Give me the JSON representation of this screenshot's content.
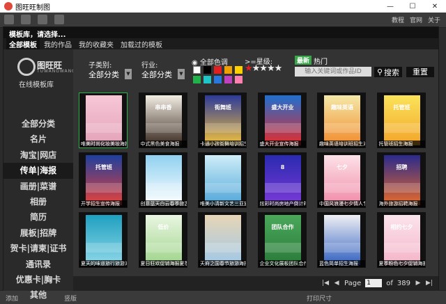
{
  "window": {
    "title": "图旺旺制图",
    "minimize": "—",
    "maximize": "☐",
    "close": "✕"
  },
  "background": {
    "links": [
      "教程",
      "官网",
      "关于"
    ],
    "bottom": [
      "添加",
      "竖版",
      "打印尺寸"
    ]
  },
  "dialog": {
    "title": "模板库，请选择...",
    "tabs": [
      "全部模板",
      "我的作品",
      "我的收藏夹",
      "加载过的模板"
    ],
    "active_tab": 0
  },
  "sidebar": {
    "logo_name": "图旺旺",
    "logo_sub": "TUWANGWANG",
    "logo_tag": "在线模板库",
    "categories": [
      "全部分类",
      "名片",
      "淘宝|网店",
      "传单|海报",
      "画册|菜谱",
      "相册",
      "简历",
      "展板|招牌",
      "贺卡|请柬|证书",
      "通讯录",
      "优惠卡|胸卡",
      "其他"
    ],
    "active_index": 3
  },
  "filters": {
    "subcategory_label": "子类别:",
    "subcategory_value": "全部分类",
    "industry_label": "行业:",
    "industry_value": "全部分类",
    "color_label": "全部色调",
    "colors": [
      "#ffffff",
      "#000000",
      "#e02020",
      "#f0a000",
      "#ffd000",
      "#22b24a",
      "#1fc6c8",
      "#2878e0",
      "#c040c0",
      "#ff80b0"
    ],
    "star_label": ">=星级:",
    "stars": "★★★★★",
    "latest_label": "最新",
    "hot_label": "热门",
    "search_placeholder": "输入关键词或作品ID",
    "search_button": "搜索",
    "reset_button": "重置"
  },
  "templates": [
    {
      "caption": "唯美时尚化妆美妆海报",
      "c1": "#f7c7d6",
      "c2": "#e3a2b8",
      "text": ""
    },
    {
      "caption": "中式黑色美食海报",
      "c1": "#f2ede3",
      "c2": "#3a2a20",
      "text": "串串香"
    },
    {
      "caption": "卡通小孩街舞培训招生海报",
      "c1": "#2c3a9a",
      "c2": "#f3c23c",
      "text": "街舞班"
    },
    {
      "caption": "盛大开业宣传海报",
      "c1": "#1f6fd0",
      "c2": "#e52b2b",
      "text": "盛大开业"
    },
    {
      "caption": "趣味英语培训班招生海报",
      "c1": "#f4e9a8",
      "c2": "#f18b2c",
      "text": "趣味英语"
    },
    {
      "caption": "托管班招生海报",
      "c1": "#fbe35a",
      "c2": "#f3a429",
      "text": "托管班"
    },
    {
      "caption": "开学招生宣传海报",
      "c1": "#1d3f9e",
      "c2": "#e8423a",
      "text": "托管班"
    },
    {
      "caption": "创意蓝天白云春季旅游海报",
      "c1": "#8fd0f0",
      "c2": "#ffffff",
      "text": ""
    },
    {
      "caption": "唯美小清新文艺三亚旅游海报",
      "c1": "#cfeef8",
      "c2": "#4fa6d8",
      "text": ""
    },
    {
      "caption": "炫彩时尚房地产倒计时海报",
      "c1": "#2a2ab0",
      "c2": "#7a3ad8",
      "text": "8"
    },
    {
      "caption": "中国风浪漫七夕情人节海报",
      "c1": "#fde2e8",
      "c2": "#f08aa8",
      "text": "七夕"
    },
    {
      "caption": "海外旅游招聘海报",
      "c1": "#2a2a8c",
      "c2": "#e86a2a",
      "text": "招聘"
    },
    {
      "caption": "夏天的味道旅行旅游海报",
      "c1": "#1fa0c0",
      "c2": "#8ed8e8",
      "text": ""
    },
    {
      "caption": "夏日狂欢促销海报夏季购",
      "c1": "#eaf6e2",
      "c2": "#9ed48a",
      "text": "低价"
    },
    {
      "caption": "天府之国春节旅游海报",
      "c1": "#e8d5b5",
      "c2": "#a0c8e8",
      "text": ""
    },
    {
      "caption": "企业文化展板团队合作海报",
      "c1": "#4aa85a",
      "c2": "#2a7a3a",
      "text": "团队合作"
    },
    {
      "caption": "蓝色简单招生海报",
      "c1": "#f0f0f4",
      "c2": "#3060c0",
      "text": ""
    },
    {
      "caption": "夏季粉色七夕促销海报",
      "c1": "#fbe4ec",
      "c2": "#f4b4c8",
      "text": "相约七夕"
    }
  ],
  "pagination": {
    "page_label": "Page",
    "current_page": "1",
    "of_label": "of",
    "total_pages": "389"
  }
}
